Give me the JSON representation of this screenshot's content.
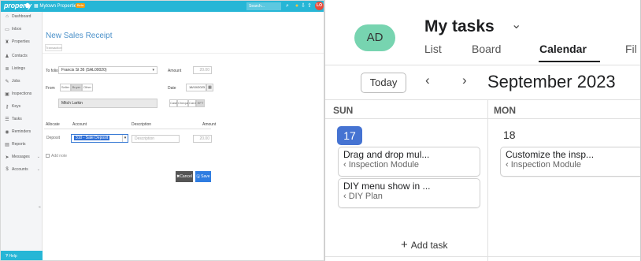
{
  "property_app": {
    "logo": "property",
    "property_selector": "Mytown Properties",
    "beta_badge": "Beta",
    "search_placeholder": "Search...",
    "user_initials": "LO",
    "sidebar": [
      {
        "label": "Dashboard",
        "icon": "home-icon"
      },
      {
        "label": "Inbox",
        "icon": "inbox-icon"
      },
      {
        "label": "Properties",
        "icon": "building-icon"
      },
      {
        "label": "Contacts",
        "icon": "contacts-icon"
      },
      {
        "label": "Listings",
        "icon": "listings-icon"
      },
      {
        "label": "Jobs",
        "icon": "wrench-icon"
      },
      {
        "label": "Inspections",
        "icon": "clipboard-icon"
      },
      {
        "label": "Keys",
        "icon": "key-icon"
      },
      {
        "label": "Tasks",
        "icon": "tasks-icon"
      },
      {
        "label": "Reminders",
        "icon": "clock-icon"
      },
      {
        "label": "Reports",
        "icon": "reports-icon"
      },
      {
        "label": "Messages",
        "icon": "send-icon"
      },
      {
        "label": "Accounts",
        "icon": "money-icon"
      }
    ],
    "help_label": "Help",
    "form": {
      "title": "New Sales Receipt",
      "sub_tab": "Transaction",
      "to_folio_label": "To folio",
      "to_folio_value": "Francis St 36 (SAL00020)",
      "amount_label": "Amount",
      "amount_value": "20.00",
      "from_label": "From",
      "from_options": [
        "Seller",
        "Buyer",
        "Other"
      ],
      "from_selected": "Buyer",
      "date_label": "Date",
      "date_value": "18/10/2023",
      "contact_value": "Mitch Larkin",
      "payment_methods": [
        "Cash",
        "Cheque",
        "Card",
        "EFT"
      ],
      "payment_selected": "EFT",
      "allocate_header": "Allocate",
      "account_header": "Account",
      "description_header": "Description",
      "amount_header": "Amount",
      "row_allocate": "Deposit",
      "row_account": "310 - Sale Deposit",
      "row_description_placeholder": "Description",
      "row_amount": "20.00",
      "add_note_label": "Add note",
      "cancel_label": "Cancel",
      "save_label": "Save"
    }
  },
  "tasks_app": {
    "avatar_initials": "AD",
    "title": "My tasks",
    "tabs": [
      {
        "label": "List"
      },
      {
        "label": "Board"
      },
      {
        "label": "Calendar"
      },
      {
        "label": "Fil"
      }
    ],
    "active_tab": "Calendar",
    "today_label": "Today",
    "month_title": "September 2023",
    "days": [
      {
        "dow": "SUN",
        "date": "17"
      },
      {
        "dow": "MON",
        "date": "18"
      }
    ],
    "sun_tasks": [
      {
        "title": "Drag and drop mul...",
        "project": "‹ Inspection Module"
      },
      {
        "title": "DIY menu show in ...",
        "project": "‹ DIY Plan"
      }
    ],
    "mon_tasks": [
      {
        "title": "Customize the insp...",
        "project": "‹ Inspection Module"
      }
    ],
    "add_task_label": "Add task"
  }
}
